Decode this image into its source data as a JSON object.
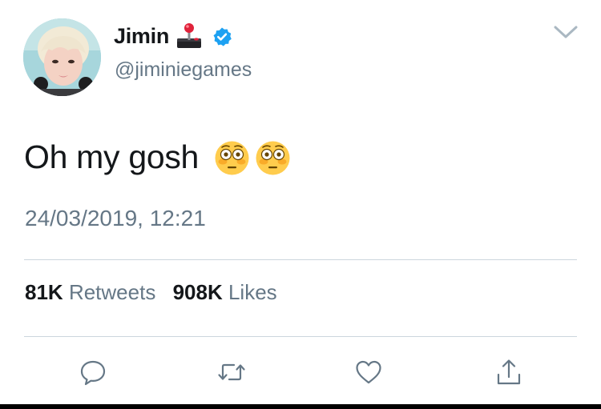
{
  "user": {
    "display_name": "Jimin",
    "name_emoji": "joystick-emoji",
    "verified": true,
    "handle": "@jiminiegames"
  },
  "tweet": {
    "text": "Oh my gosh",
    "emojis": [
      "flushed-face-emoji",
      "flushed-face-emoji"
    ],
    "timestamp": "24/03/2019, 12:21"
  },
  "stats": {
    "retweets_count": "81K",
    "retweets_label": "Retweets",
    "likes_count": "908K",
    "likes_label": "Likes"
  },
  "actions": {
    "reply_icon": "speech-bubble-icon",
    "retweet_icon": "retweet-icon",
    "like_icon": "heart-icon",
    "share_icon": "share-icon"
  },
  "colors": {
    "text": "#14171a",
    "secondary": "#657786",
    "verified_blue": "#1da1f2",
    "divider": "#ccd6dd"
  }
}
